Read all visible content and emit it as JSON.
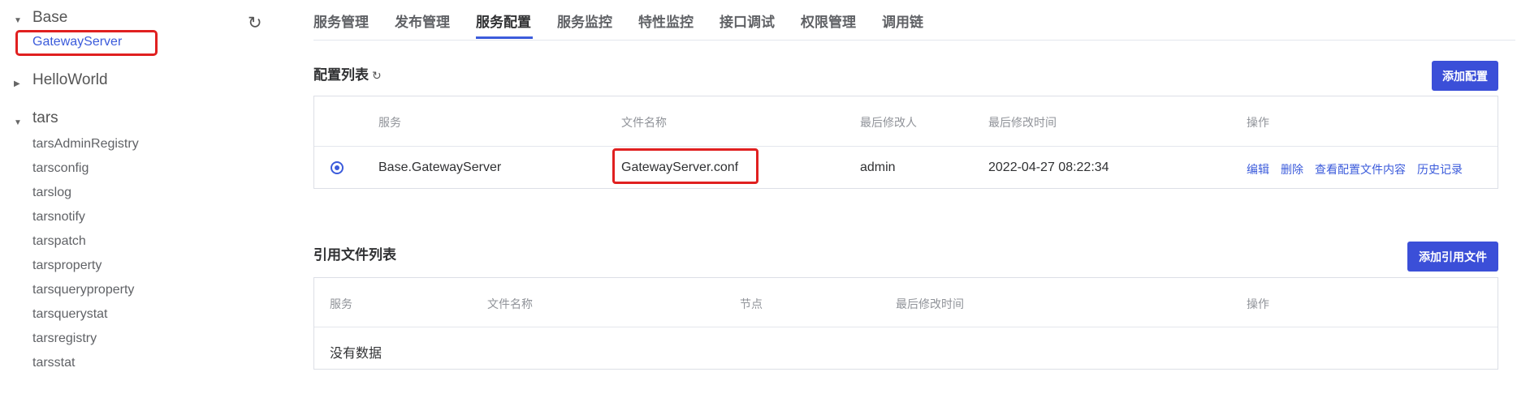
{
  "sidebar": {
    "groups": [
      {
        "label": "Base",
        "expanded": true,
        "children": [
          "GatewayServer"
        ]
      },
      {
        "label": "HelloWorld",
        "expanded": false
      },
      {
        "label": "tars",
        "expanded": true,
        "children": [
          "tarsAdminRegistry",
          "tarsconfig",
          "tarslog",
          "tarsnotify",
          "tarspatch",
          "tarsproperty",
          "tarsqueryproperty",
          "tarsquerystat",
          "tarsregistry",
          "tarsstat"
        ]
      }
    ],
    "selected": "GatewayServer"
  },
  "tabs": [
    "服务管理",
    "发布管理",
    "服务配置",
    "服务监控",
    "特性监控",
    "接口调试",
    "权限管理",
    "调用链"
  ],
  "active_tab": "服务配置",
  "config_section": {
    "title": "配置列表",
    "add_button": "添加配置",
    "columns": [
      "服务",
      "文件名称",
      "最后修改人",
      "最后修改时间",
      "操作"
    ],
    "rows": [
      {
        "service": "Base.GatewayServer",
        "file": "GatewayServer.conf",
        "modifier": "admin",
        "time": "2022-04-27 08:22:34",
        "actions": [
          "编辑",
          "删除",
          "查看配置文件内容",
          "历史记录"
        ]
      }
    ]
  },
  "ref_section": {
    "title": "引用文件列表",
    "add_button": "添加引用文件",
    "columns": [
      "服务",
      "文件名称",
      "节点",
      "最后修改时间",
      "操作"
    ],
    "empty_text": "没有数据"
  },
  "colors": {
    "accent": "#3b5bdb",
    "highlight": "#e02020"
  }
}
